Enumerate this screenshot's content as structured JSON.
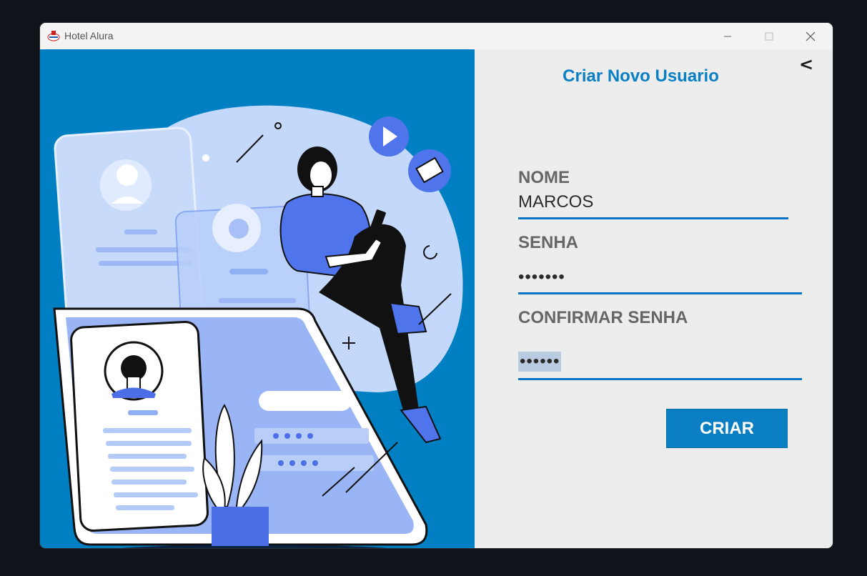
{
  "window": {
    "title": "Hotel Alura",
    "controls": [
      "minimize-icon",
      "maximize-icon",
      "close-icon"
    ]
  },
  "form": {
    "title": "Criar Novo Usuario",
    "back_label": "<",
    "nome_label": "NOME",
    "nome_value": "MARCOS",
    "senha_label": "SENHA",
    "senha_value": "•••••••",
    "confirmar_label": "CONFIRMAR SENHA",
    "confirmar_value": "••••••",
    "submit_label": "CRIAR"
  },
  "colors": {
    "accent": "#0a7fc3",
    "left_panel_bg": "#0080c2",
    "form_bg": "#ededed",
    "label": "#666666"
  }
}
